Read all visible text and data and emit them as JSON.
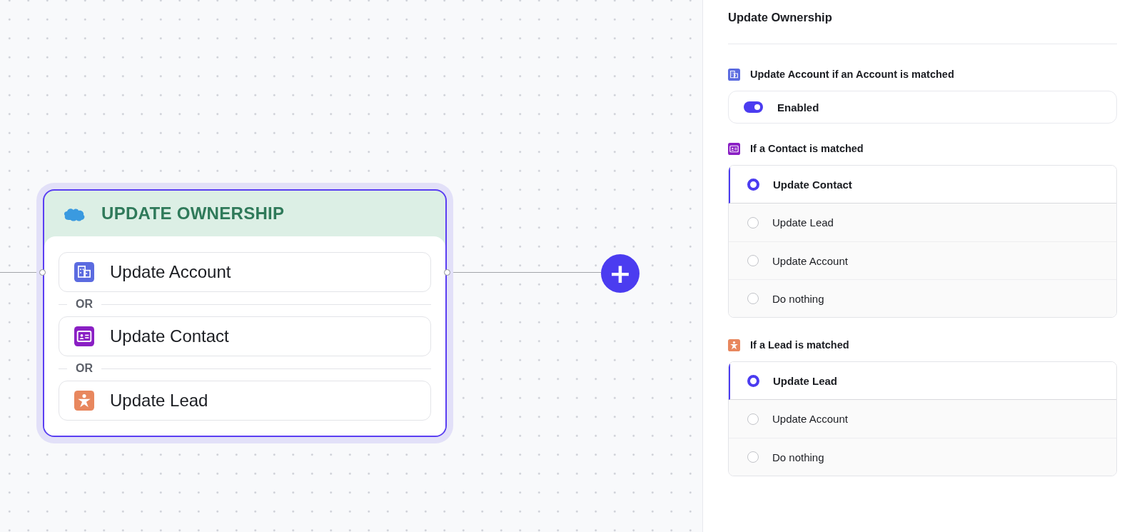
{
  "canvas": {
    "node": {
      "title": "UPDATE OWNERSHIP",
      "selected": true,
      "actions": [
        {
          "kind": "account",
          "label": "Update Account"
        },
        {
          "kind": "contact",
          "label": "Update Contact",
          "separator": "OR"
        },
        {
          "kind": "lead",
          "label": "Update Lead",
          "separator": "OR"
        }
      ]
    },
    "add_button": "+"
  },
  "panel": {
    "title": "Update Ownership",
    "sections": [
      {
        "kind": "account",
        "heading": "Update Account if an Account is matched",
        "toggle": {
          "on": true,
          "label": "Enabled"
        }
      },
      {
        "kind": "contact",
        "heading": "If a Contact is matched",
        "options": [
          {
            "label": "Update Contact",
            "selected": true
          },
          {
            "label": "Update Lead",
            "selected": false
          },
          {
            "label": "Update Account",
            "selected": false
          },
          {
            "label": "Do nothing",
            "selected": false
          }
        ]
      },
      {
        "kind": "lead",
        "heading": "If a Lead is matched",
        "options": [
          {
            "label": "Update Lead",
            "selected": true
          },
          {
            "label": "Update Account",
            "selected": false
          },
          {
            "label": "Do nothing",
            "selected": false
          }
        ]
      }
    ]
  }
}
